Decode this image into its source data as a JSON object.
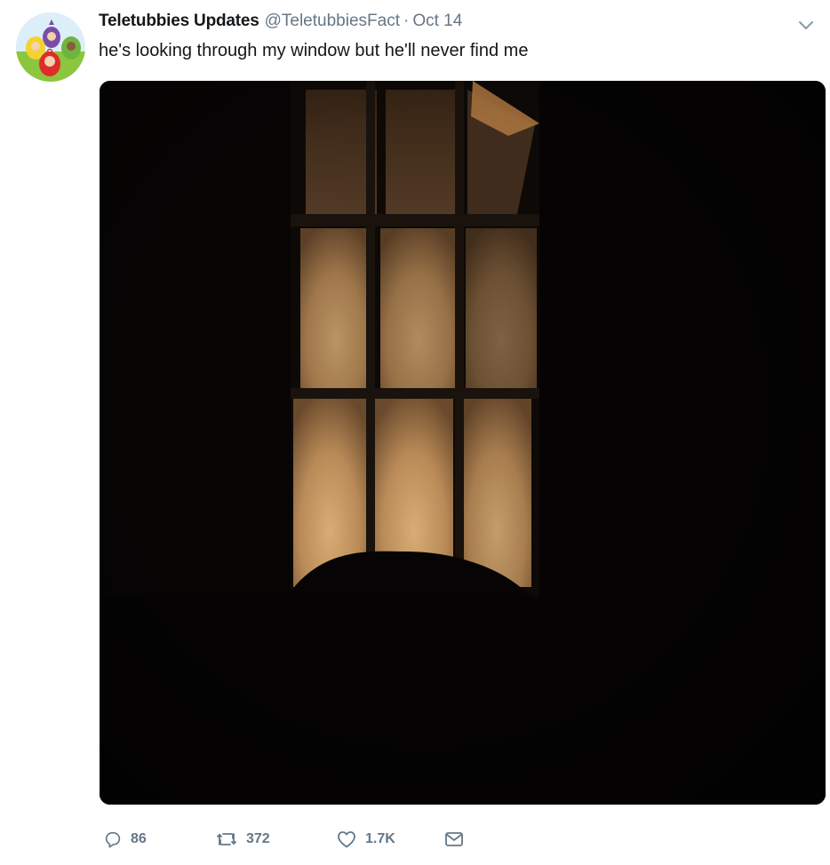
{
  "tweet": {
    "display_name": "Teletubbies Updates",
    "handle": "@TeletubbiesFact",
    "separator": "·",
    "date": "Oct 14",
    "text": "he's looking through my window but he'll never find me"
  },
  "actions": {
    "reply_count": "86",
    "retweet_count": "372",
    "like_count": "1.7K"
  },
  "icons": {
    "reply": "reply-icon",
    "retweet": "retweet-icon",
    "like": "heart-icon",
    "message": "envelope-icon",
    "menu": "chevron-down-icon"
  },
  "colors": {
    "secondary_text": "#657786",
    "primary_text": "#14171a",
    "window_glow": "#c9a06a"
  }
}
